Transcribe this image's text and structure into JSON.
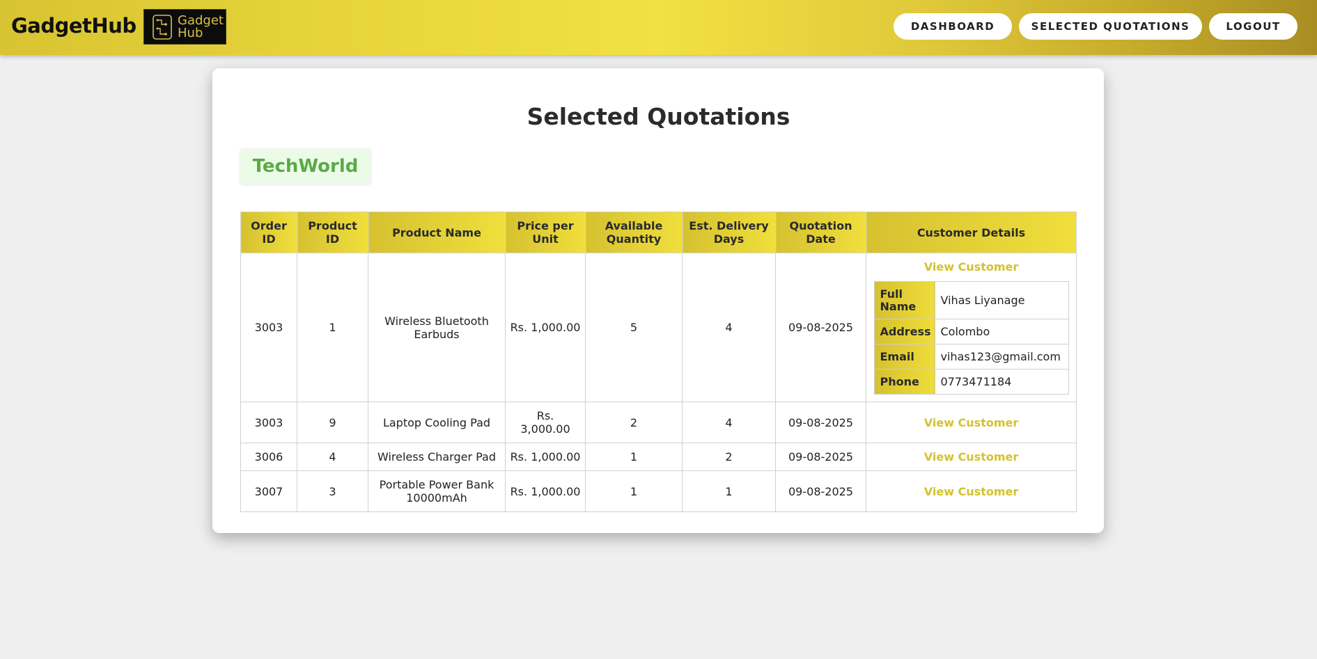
{
  "header": {
    "brand": "GadgetHub",
    "logo_line1": "Gadget",
    "logo_line2": "Hub",
    "nav": {
      "dashboard": "DASHBOARD",
      "selected_quotations": "SELECTED QUOTATIONS",
      "logout": "LOGOUT"
    }
  },
  "main": {
    "title": "Selected Quotations",
    "shop_name": "TechWorld",
    "columns": [
      "Order ID",
      "Product ID",
      "Product Name",
      "Price per Unit",
      "Available Quantity",
      "Est. Delivery Days",
      "Quotation Date",
      "Customer Details"
    ],
    "rows": [
      {
        "order_id": "3003",
        "product_id": "1",
        "product_name": "Wireless Bluetooth Earbuds",
        "price": "Rs. 1,000.00",
        "quantity": "5",
        "delivery_days": "4",
        "date": "09-08-2025",
        "action": "View Customer"
      },
      {
        "order_id": "3003",
        "product_id": "9",
        "product_name": "Laptop Cooling Pad",
        "price": "Rs. 3,000.00",
        "quantity": "2",
        "delivery_days": "4",
        "date": "09-08-2025",
        "action": "View Customer"
      },
      {
        "order_id": "3006",
        "product_id": "4",
        "product_name": "Wireless Charger Pad",
        "price": "Rs. 1,000.00",
        "quantity": "1",
        "delivery_days": "2",
        "date": "09-08-2025",
        "action": "View Customer"
      },
      {
        "order_id": "3007",
        "product_id": "3",
        "product_name": "Portable Power Bank 10000mAh",
        "price": "Rs. 1,000.00",
        "quantity": "1",
        "delivery_days": "1",
        "date": "09-08-2025",
        "action": "View Customer"
      }
    ],
    "customer": {
      "labels": {
        "full_name": "Full Name",
        "address": "Address",
        "email": "Email",
        "phone": "Phone"
      },
      "full_name": "Vihas Liyanage",
      "address": "Colombo",
      "email": "vihas123@gmail.com",
      "phone": "0773471184"
    }
  },
  "colors": {
    "accent_gold": "#e6d43a",
    "link_gold": "#d3c22c",
    "shop_green": "#5aaa48"
  }
}
